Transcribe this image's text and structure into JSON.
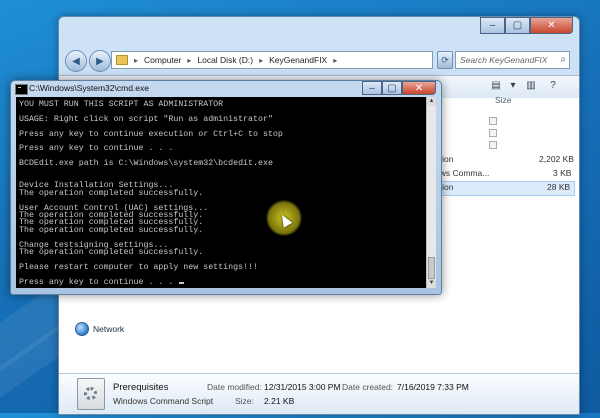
{
  "explorer": {
    "breadcrumb": [
      "Computer",
      "Local Disk (D:)",
      "KeyGenandFIX"
    ],
    "search_placeholder": "Search KeyGenandFIX",
    "columns": {
      "size": "Size"
    },
    "rows": [
      {
        "type_partial": "ation",
        "size": "2,202 KB"
      },
      {
        "type_partial": "ows Comma...",
        "size": "3 KB"
      },
      {
        "type_partial": "ation",
        "size": "28 KB"
      }
    ],
    "navigation": {
      "network": "Network"
    },
    "details": {
      "name": "Prerequisites",
      "type": "Windows Command Script",
      "modified_label": "Date modified:",
      "modified_value": "12/31/2015 3:00 PM",
      "size_label": "Size:",
      "size_value": "2.21 KB",
      "created_label": "Date created:",
      "created_value": "7/16/2019 7:33 PM"
    }
  },
  "cmd": {
    "title": "C:\\Windows\\System32\\cmd.exe",
    "lines": [
      "YOU MUST RUN THIS SCRIPT AS ADMINISTRATOR",
      "",
      "USAGE: Right click on script \"Run as administrator\"",
      "",
      "Press any key to continue execution or Ctrl+C to stop",
      "",
      "Press any key to continue . . .",
      "",
      "BCDEdit.exe path is C:\\Windows\\system32\\bcdedit.exe",
      "",
      "",
      "Device Installation Settings...",
      "The operation completed successfully.",
      "",
      "User Account Control (UAC) settings...",
      "The operation completed successfully.",
      "The operation completed successfully.",
      "The operation completed successfully.",
      "",
      "Change testsigning settings...",
      "The operation completed successfully.",
      "",
      "Please restart computer to apply new settings!!!",
      "",
      "Press any key to continue . . . "
    ]
  }
}
